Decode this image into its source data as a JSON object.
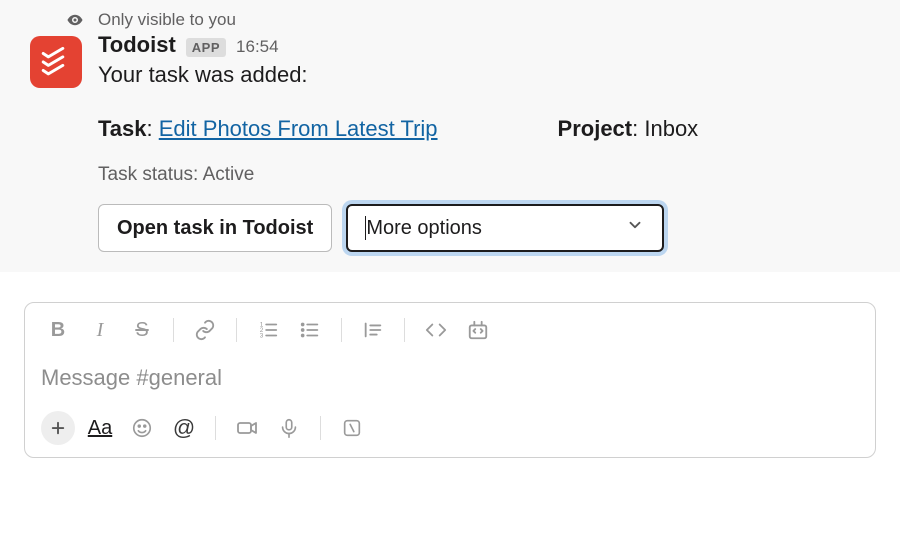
{
  "visibility": {
    "label": "Only visible to you"
  },
  "message": {
    "app_name": "Todoist",
    "app_badge": "APP",
    "timestamp": "16:54",
    "added_text": "Your task was added:",
    "fields": {
      "task": {
        "label": "Task",
        "link_text": "Edit Photos From Latest Trip"
      },
      "project": {
        "label": "Project",
        "value": "Inbox"
      }
    },
    "status": {
      "label": "Task status",
      "value": "Active"
    },
    "actions": {
      "open_label": "Open task in Todoist",
      "more_label": "More options"
    }
  },
  "composer": {
    "placeholder": "Message #general"
  }
}
